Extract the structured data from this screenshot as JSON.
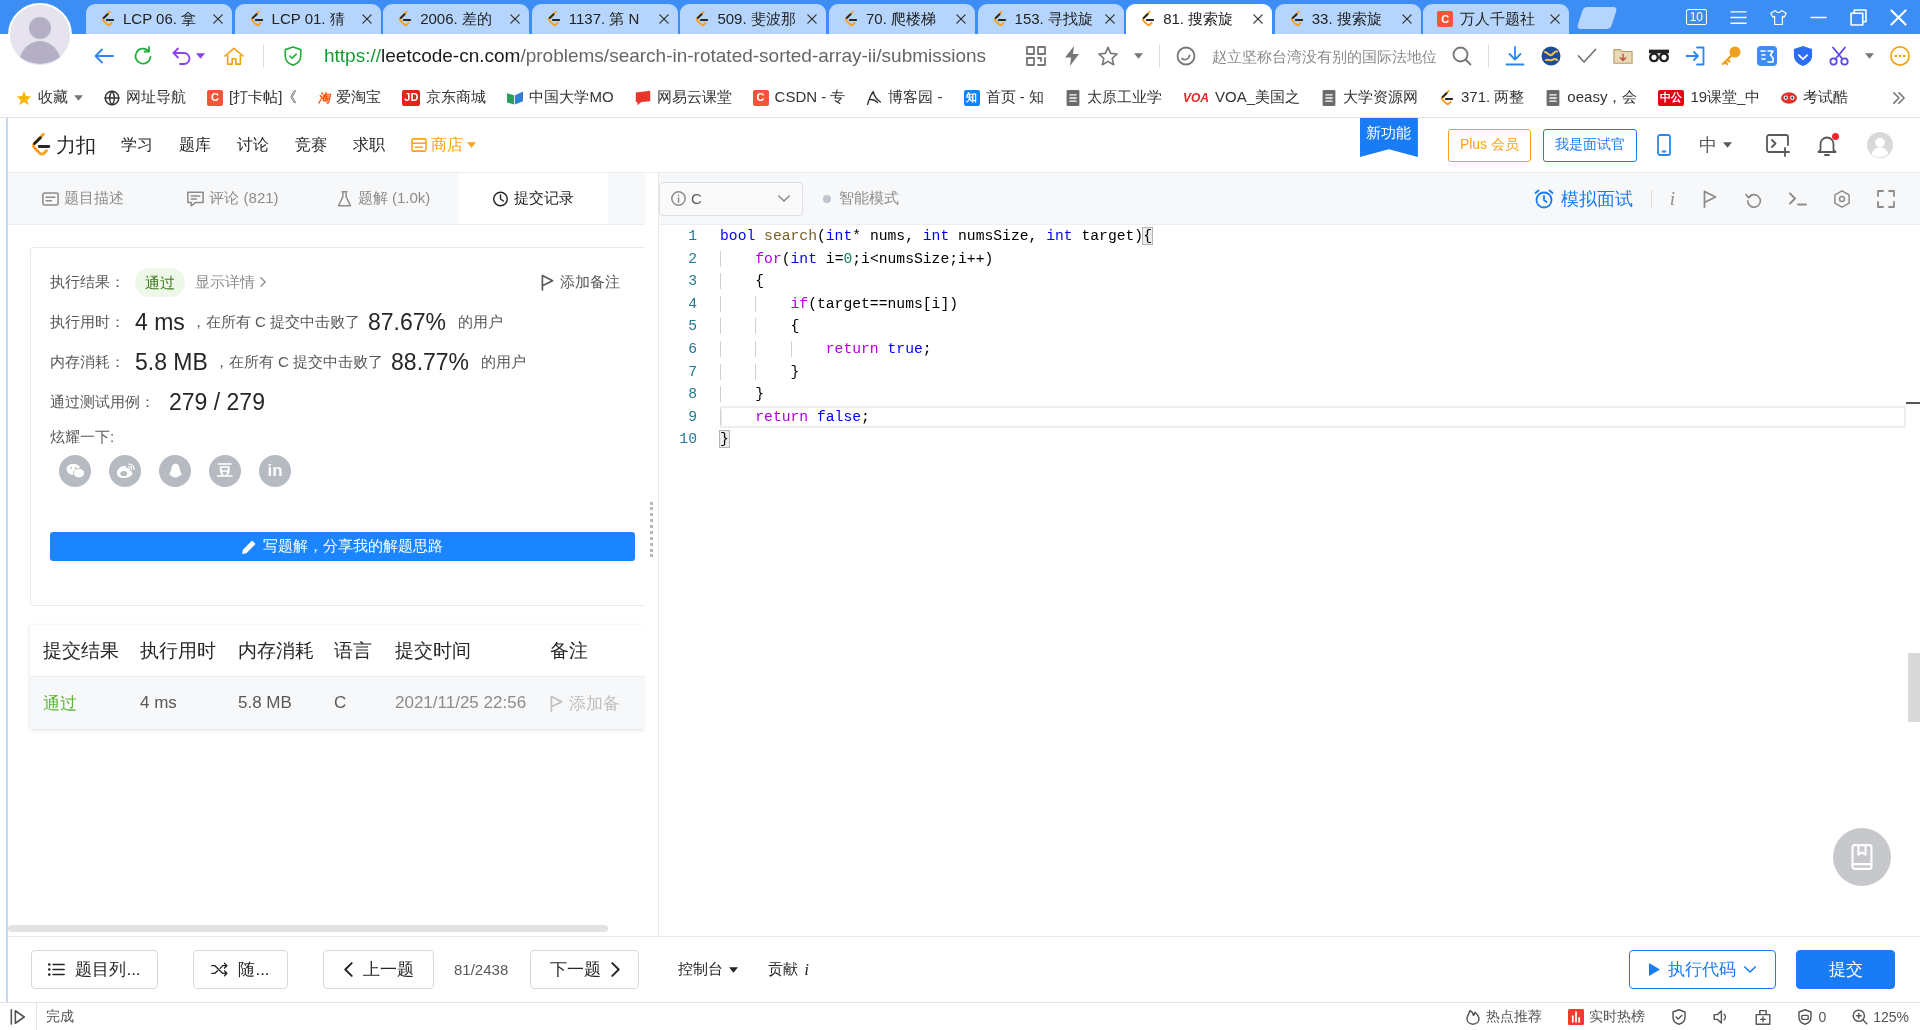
{
  "browser": {
    "tabs": [
      {
        "title": "LCP 06. 拿",
        "kind": "leetcode",
        "selected": false
      },
      {
        "title": "LCP 01. 猜",
        "kind": "leetcode",
        "selected": false
      },
      {
        "title": "2006. 差的",
        "kind": "leetcode",
        "selected": false
      },
      {
        "title": "1137. 第 N",
        "kind": "leetcode",
        "selected": false
      },
      {
        "title": "509. 斐波那",
        "kind": "leetcode",
        "selected": false
      },
      {
        "title": "70. 爬楼梯",
        "kind": "leetcode",
        "selected": false
      },
      {
        "title": "153. 寻找旋",
        "kind": "leetcode",
        "selected": false
      },
      {
        "title": "81. 搜索旋",
        "kind": "leetcode",
        "selected": true
      },
      {
        "title": "33. 搜索旋",
        "kind": "leetcode",
        "selected": false
      },
      {
        "title": "万人千题社",
        "kind": "tile",
        "icon_text": "C",
        "color": "#f4553a",
        "selected": false
      }
    ],
    "tab_count": "10",
    "address": {
      "scheme": "https://",
      "host": "leetcode-cn.com",
      "path": "/problems/search-in-rotated-sorted-array-ii/submissions"
    },
    "search_placeholder": "赵立坚称台湾没有别的国际法地位",
    "bookmarks": [
      {
        "label": "收藏",
        "kind": "star"
      },
      {
        "label": "网址导航",
        "kind": "globe"
      },
      {
        "label": "[打卡帖]《",
        "kind": "tile",
        "icon_text": "C",
        "color": "#f4553a"
      },
      {
        "label": "爱淘宝",
        "kind": "glyph",
        "icon_text": "淘",
        "color": "#ff5000"
      },
      {
        "label": "京东商城",
        "kind": "tile",
        "icon_text": "JD",
        "color": "#e1251b"
      },
      {
        "label": "中国大学MO",
        "kind": "book"
      },
      {
        "label": "网易云课堂",
        "kind": "cloudclass"
      },
      {
        "label": "CSDN - 专",
        "kind": "tile",
        "icon_text": "C",
        "color": "#f4553a"
      },
      {
        "label": "博客园 -",
        "kind": "sketch"
      },
      {
        "label": "首页 - 知",
        "kind": "tile",
        "icon_text": "知",
        "color": "#0a84ff"
      },
      {
        "label": "太原工业学",
        "kind": "page"
      },
      {
        "label": "VOA_美国之",
        "kind": "glyph",
        "icon_text": "VOA",
        "color": "#e52521"
      },
      {
        "label": "大学资源网",
        "kind": "page"
      },
      {
        "label": "371. 两整",
        "kind": "leetcode"
      },
      {
        "label": "oeasy，会",
        "kind": "page"
      },
      {
        "label": "19课堂_中",
        "kind": "tile",
        "icon_text": "中公",
        "color": "#e60012"
      },
      {
        "label": "考试酷",
        "kind": "mask"
      }
    ]
  },
  "site_header": {
    "logo": "力扣",
    "nav": [
      {
        "label": "学习",
        "kind": "link"
      },
      {
        "label": "题库",
        "kind": "link"
      },
      {
        "label": "讨论",
        "kind": "link"
      },
      {
        "label": "竞赛",
        "kind": "link"
      },
      {
        "label": "求职",
        "kind": "link"
      },
      {
        "label": "商店",
        "kind": "shop"
      }
    ],
    "new_feature": "新功能",
    "plus": "Plus 会员",
    "interviewer": "我是面试官",
    "language": "中",
    "has_notification": true
  },
  "panel_tabs": [
    {
      "label": "题目描述",
      "kind": "description",
      "selected": false
    },
    {
      "label": "评论 (821)",
      "kind": "comments",
      "selected": false
    },
    {
      "label": "题解 (1.0k)",
      "kind": "solutions",
      "selected": false
    },
    {
      "label": "提交记录",
      "kind": "submissions",
      "selected": true
    }
  ],
  "result": {
    "status_label": "执行结果：",
    "status": "通过",
    "details": "显示详情",
    "add_note": "添加备注",
    "runtime_label": "执行用时：",
    "runtime": "4 ms",
    "runtime_text": "，在所有 C 提交中击败了",
    "runtime_pct": "87.67%",
    "runtime_users": "的用户",
    "memory_label": "内存消耗：",
    "memory": "5.8 MB",
    "memory_text": "，在所有 C 提交中击败了",
    "memory_pct": "88.77%",
    "memory_users": "的用户",
    "cases_label": "通过测试用例：",
    "cases": "279 / 279",
    "share_label": "炫耀一下:",
    "share": [
      {
        "kind": "wechat"
      },
      {
        "kind": "weibo"
      },
      {
        "kind": "qq"
      },
      {
        "kind": "douban",
        "text": "豆"
      },
      {
        "kind": "linkedin",
        "text": "in"
      }
    ],
    "write_solution": "写题解，分享我的解题思路"
  },
  "submissions": {
    "columns": [
      "提交结果",
      "执行用时",
      "内存消耗",
      "语言",
      "提交时间",
      "备注"
    ],
    "rows": [
      {
        "status": "通过",
        "passed": true,
        "runtime": "4 ms",
        "memory": "5.8 MB",
        "language": "C",
        "time": "2021/11/25 22:56",
        "note": "添加备"
      }
    ]
  },
  "editor": {
    "language": "C",
    "smart_mode": "智能模式",
    "smart_mode_on": false,
    "mock_interview": "模拟面试",
    "info": "i",
    "lines": [
      {
        "num": "1",
        "current": false,
        "tokens": [
          {
            "text": "bool",
            "kind": "keyword"
          },
          {
            "text": " search",
            "kind": "function"
          },
          {
            "text": "(",
            "kind": "plain"
          },
          {
            "text": "int",
            "kind": "keyword"
          },
          {
            "text": "* nums, ",
            "kind": "plain"
          },
          {
            "text": "int",
            "kind": "keyword"
          },
          {
            "text": " numsSize, ",
            "kind": "plain"
          },
          {
            "text": "int",
            "kind": "keyword"
          },
          {
            "text": " target)",
            "kind": "plain"
          },
          {
            "text": "{",
            "kind": "bracket"
          }
        ]
      },
      {
        "num": "2",
        "current": false,
        "tokens": [
          {
            "text": "    for",
            "kind": "control"
          },
          {
            "text": "(",
            "kind": "plain"
          },
          {
            "text": "int",
            "kind": "keyword"
          },
          {
            "text": " i=",
            "kind": "plain"
          },
          {
            "text": "0",
            "kind": "number"
          },
          {
            "text": ";i<numsSize;i++)",
            "kind": "plain"
          }
        ]
      },
      {
        "num": "3",
        "current": false,
        "tokens": [
          {
            "text": "    {",
            "kind": "plain"
          }
        ]
      },
      {
        "num": "4",
        "current": false,
        "tokens": [
          {
            "text": "        if",
            "kind": "control"
          },
          {
            "text": "(target==nums[i])",
            "kind": "plain"
          }
        ]
      },
      {
        "num": "5",
        "current": false,
        "tokens": [
          {
            "text": "        {",
            "kind": "plain"
          }
        ]
      },
      {
        "num": "6",
        "current": false,
        "tokens": [
          {
            "text": "            return",
            "kind": "control"
          },
          {
            "text": " true",
            "kind": "keyword"
          },
          {
            "text": ";",
            "kind": "plain"
          }
        ]
      },
      {
        "num": "7",
        "current": false,
        "tokens": [
          {
            "text": "        }",
            "kind": "plain"
          }
        ]
      },
      {
        "num": "8",
        "current": false,
        "tokens": [
          {
            "text": "    }",
            "kind": "plain"
          }
        ]
      },
      {
        "num": "9",
        "current": true,
        "tokens": [
          {
            "text": "    return",
            "kind": "control"
          },
          {
            "text": " false",
            "kind": "keyword"
          },
          {
            "text": ";",
            "kind": "plain"
          }
        ]
      },
      {
        "num": "10",
        "current": false,
        "tokens": [
          {
            "text": "}",
            "kind": "bracket"
          }
        ]
      }
    ]
  },
  "footer": {
    "problem_list": "题目列...",
    "random": "随...",
    "prev": "上一题",
    "counter": "81/2438",
    "next": "下一题",
    "console": "控制台",
    "contribute": "贡献",
    "contribute_icon": "i",
    "run": "执行代码",
    "submit": "提交"
  },
  "status_bar": {
    "status": "完成",
    "items": [
      {
        "kind": "fire",
        "label": "热点推荐"
      },
      {
        "kind": "chart",
        "label": "实时热榜"
      },
      {
        "kind": "shield"
      },
      {
        "kind": "speaker"
      },
      {
        "kind": "box"
      },
      {
        "kind": "adblock",
        "label": "0"
      },
      {
        "kind": "zoom",
        "label": "125%"
      }
    ]
  }
}
